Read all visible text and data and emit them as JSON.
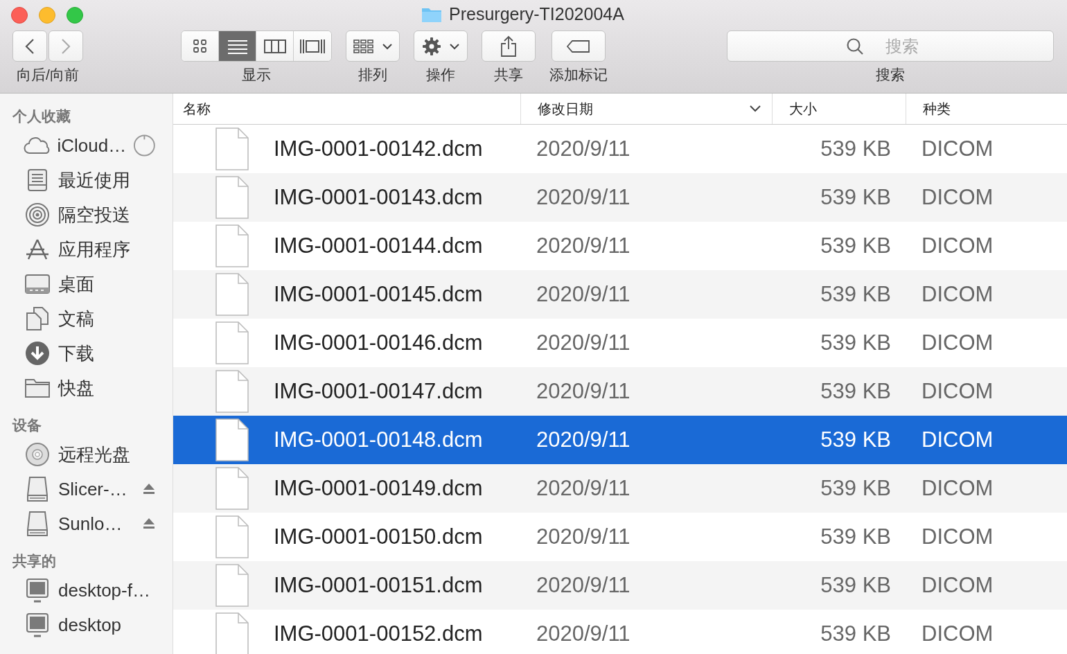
{
  "window": {
    "title": "Presurgery-TI202004A"
  },
  "toolbar": {
    "nav": {
      "label": "向后/向前"
    },
    "view": {
      "label": "显示",
      "modes": [
        {
          "kind": "icons",
          "selected": false
        },
        {
          "kind": "list",
          "selected": true
        },
        {
          "kind": "columns",
          "selected": false
        },
        {
          "kind": "gallery",
          "selected": false
        }
      ]
    },
    "arrange": {
      "label": "排列"
    },
    "action": {
      "label": "操作"
    },
    "share": {
      "label": "共享"
    },
    "tags": {
      "label": "添加标记"
    },
    "search": {
      "placeholder": "搜索",
      "label": "搜索"
    }
  },
  "sidebar": {
    "sections": [
      {
        "title": "个人收藏",
        "items": [
          {
            "label": "iCloud…",
            "kind": "icloud",
            "eject": false
          },
          {
            "label": "最近使用",
            "kind": "recents",
            "eject": false
          },
          {
            "label": "隔空投送",
            "kind": "airdrop",
            "eject": false
          },
          {
            "label": "应用程序",
            "kind": "apps",
            "eject": false
          },
          {
            "label": "桌面",
            "kind": "desktop",
            "eject": false
          },
          {
            "label": "文稿",
            "kind": "documents",
            "eject": false
          },
          {
            "label": "下载",
            "kind": "downloads",
            "eject": false
          },
          {
            "label": "快盘",
            "kind": "folder",
            "eject": false
          }
        ]
      },
      {
        "title": "设备",
        "items": [
          {
            "label": "远程光盘",
            "kind": "disc",
            "eject": false
          },
          {
            "label": "Slicer-…",
            "kind": "drive",
            "eject": true
          },
          {
            "label": "Sunlo…",
            "kind": "drive",
            "eject": true
          }
        ]
      },
      {
        "title": "共享的",
        "items": [
          {
            "label": "desktop-f…",
            "kind": "computer",
            "eject": false
          },
          {
            "label": "desktop",
            "kind": "computer",
            "eject": false
          }
        ]
      }
    ]
  },
  "table": {
    "columns": [
      {
        "label": "名称",
        "sorted": false
      },
      {
        "label": "修改日期",
        "sorted": true
      },
      {
        "label": "大小",
        "sorted": false
      },
      {
        "label": "种类",
        "sorted": false
      }
    ],
    "rows": [
      {
        "name": "IMG-0001-00142.dcm",
        "date": "2020/9/11",
        "size": "539 KB",
        "kind": "DICOM",
        "selected": false
      },
      {
        "name": "IMG-0001-00143.dcm",
        "date": "2020/9/11",
        "size": "539 KB",
        "kind": "DICOM",
        "selected": false
      },
      {
        "name": "IMG-0001-00144.dcm",
        "date": "2020/9/11",
        "size": "539 KB",
        "kind": "DICOM",
        "selected": false
      },
      {
        "name": "IMG-0001-00145.dcm",
        "date": "2020/9/11",
        "size": "539 KB",
        "kind": "DICOM",
        "selected": false
      },
      {
        "name": "IMG-0001-00146.dcm",
        "date": "2020/9/11",
        "size": "539 KB",
        "kind": "DICOM",
        "selected": false
      },
      {
        "name": "IMG-0001-00147.dcm",
        "date": "2020/9/11",
        "size": "539 KB",
        "kind": "DICOM",
        "selected": false
      },
      {
        "name": "IMG-0001-00148.dcm",
        "date": "2020/9/11",
        "size": "539 KB",
        "kind": "DICOM",
        "selected": true
      },
      {
        "name": "IMG-0001-00149.dcm",
        "date": "2020/9/11",
        "size": "539 KB",
        "kind": "DICOM",
        "selected": false
      },
      {
        "name": "IMG-0001-00150.dcm",
        "date": "2020/9/11",
        "size": "539 KB",
        "kind": "DICOM",
        "selected": false
      },
      {
        "name": "IMG-0001-00151.dcm",
        "date": "2020/9/11",
        "size": "539 KB",
        "kind": "DICOM",
        "selected": false
      },
      {
        "name": "IMG-0001-00152.dcm",
        "date": "2020/9/11",
        "size": "539 KB",
        "kind": "DICOM",
        "selected": false
      }
    ]
  }
}
